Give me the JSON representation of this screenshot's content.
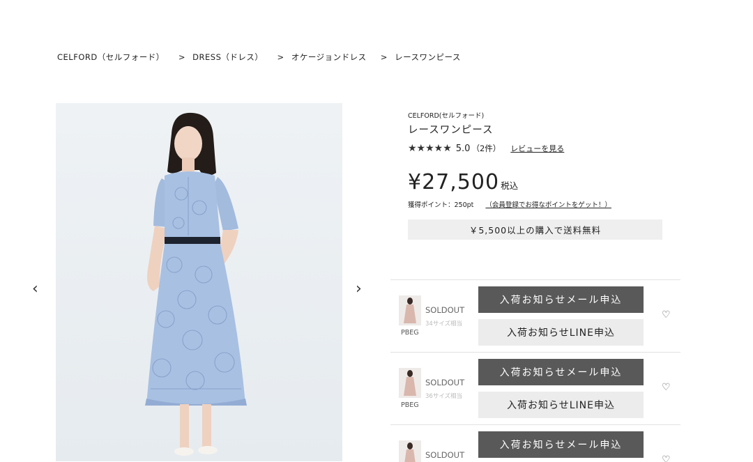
{
  "breadcrumb": {
    "items": [
      "CELFORD（セルフォード）",
      "DRESS（ドレス）",
      "オケージョンドレス",
      "レースワンピース"
    ],
    "separator": ">"
  },
  "gallery": {
    "prev_icon": "chevron-left-icon",
    "next_icon": "chevron-right-icon",
    "dress_color": "#a7bfe0"
  },
  "product": {
    "brand": "CELFORD(セルフォード)",
    "title": "レースワンピース",
    "stars": "★★★★★",
    "rating": "5.0",
    "review_count": "（2件）",
    "review_link": "レビューを見る",
    "price": "¥27,500",
    "tax_label": "税込",
    "points": "獲得ポイント：250pt",
    "points_link": "（会員登録でお得なポイントをゲット！）",
    "shipping_notice": "￥5,500以上の購入で送料無料"
  },
  "variants": [
    {
      "color": "PBEG",
      "status": "SOLDOUT",
      "size": "34サイズ相当",
      "mail_label": "入荷お知らせメール申込",
      "line_label": "入荷お知らせLINE申込"
    },
    {
      "color": "PBEG",
      "status": "SOLDOUT",
      "size": "36サイズ相当",
      "mail_label": "入荷お知らせメール申込",
      "line_label": "入荷お知らせLINE申込"
    },
    {
      "status": "SOLDOUT",
      "mail_label": "入荷お知らせメール申込"
    }
  ],
  "icons": {
    "favorite": "heart-icon"
  }
}
